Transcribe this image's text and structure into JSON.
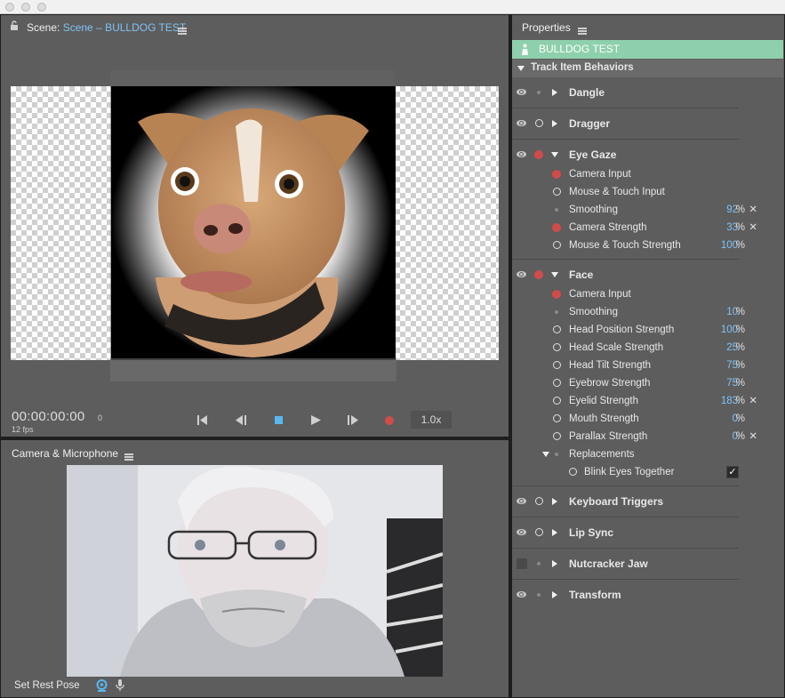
{
  "scene": {
    "label": "Scene:",
    "name": "Scene – BULLDOG TEST",
    "timecode": "00:00:00:00",
    "frame": "0",
    "fps": "12 fps",
    "speed": "1.0x"
  },
  "camera": {
    "title": "Camera & Microphone",
    "rest_pose": "Set Rest Pose"
  },
  "properties": {
    "title": "Properties",
    "puppet": "BULLDOG TEST",
    "section": "Track Item Behaviors",
    "groups": {
      "dangle": "Dangle",
      "dragger": "Dragger",
      "eye_gaze": "Eye Gaze",
      "face": "Face",
      "keyboard": "Keyboard Triggers",
      "lip_sync": "Lip Sync",
      "nutcracker": "Nutcracker Jaw",
      "transform": "Transform"
    },
    "eye_gaze": {
      "camera_input": "Camera Input",
      "mouse_touch_input": "Mouse & Touch Input",
      "smoothing": "Smoothing",
      "smoothing_val": "92",
      "camera_strength": "Camera Strength",
      "camera_strength_val": "33",
      "mouse_touch_strength": "Mouse & Touch Strength",
      "mouse_touch_strength_val": "100"
    },
    "face": {
      "camera_input": "Camera Input",
      "smoothing": "Smoothing",
      "smoothing_val": "10",
      "head_position": "Head Position Strength",
      "head_position_val": "100",
      "head_scale": "Head Scale Strength",
      "head_scale_val": "25",
      "head_tilt": "Head Tilt Strength",
      "head_tilt_val": "75",
      "eyebrow": "Eyebrow Strength",
      "eyebrow_val": "75",
      "eyelid": "Eyelid Strength",
      "eyelid_val": "183",
      "mouth": "Mouth Strength",
      "mouth_val": "0",
      "parallax": "Parallax Strength",
      "parallax_val": "0",
      "replacements": "Replacements",
      "blink": "Blink Eyes Together"
    },
    "pct": "%",
    "x": "✕",
    "check": "✓"
  },
  "colors": {
    "accent": "#7fc3f5",
    "record": "#d24b4b",
    "puppet_bar": "#8ed0ad",
    "panel": "#5d5d5d"
  }
}
